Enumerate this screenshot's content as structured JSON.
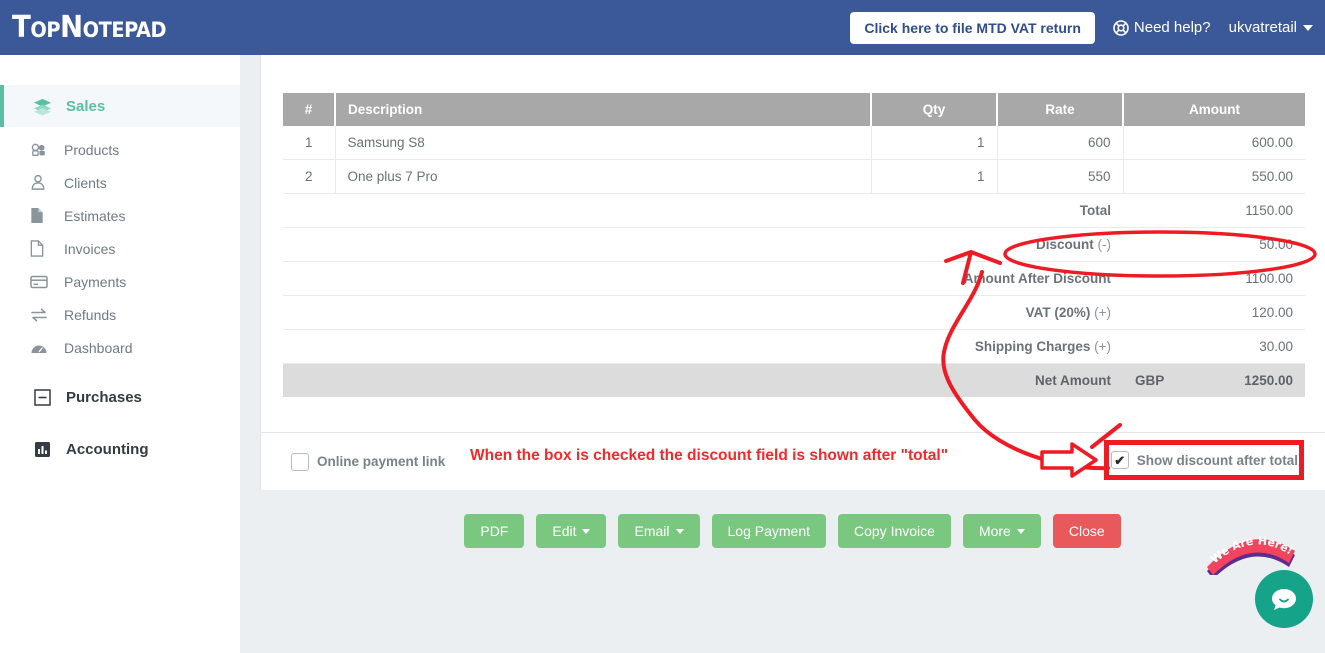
{
  "header": {
    "logo": "TopNotepad",
    "mtd_button": "Click here to file MTD VAT return",
    "need_help": "Need help?",
    "help_icon": "lifebuoy-icon",
    "user": "ukvatretail",
    "caret_icon": "caret-down-icon"
  },
  "sidebar": {
    "groups": [
      {
        "label": "Sales",
        "icon": "layers-icon",
        "active": true
      },
      {
        "label": "Purchases",
        "icon": "minus-square-icon",
        "active": false
      },
      {
        "label": "Accounting",
        "icon": "bar-chart-icon",
        "active": false
      }
    ],
    "sales_items": [
      {
        "label": "Products",
        "icon": "boxes-icon"
      },
      {
        "label": "Clients",
        "icon": "user-icon"
      },
      {
        "label": "Estimates",
        "icon": "document-filled-icon"
      },
      {
        "label": "Invoices",
        "icon": "document-outline-icon"
      },
      {
        "label": "Payments",
        "icon": "credit-card-icon"
      },
      {
        "label": "Refunds",
        "icon": "exchange-arrows-icon"
      },
      {
        "label": "Dashboard",
        "icon": "gauge-icon"
      }
    ]
  },
  "invoice": {
    "columns": [
      "#",
      "Description",
      "Qty",
      "Rate",
      "Amount"
    ],
    "rows": [
      {
        "idx": "1",
        "description": "Samsung S8",
        "qty": "1",
        "rate": "600",
        "amount": "600.00"
      },
      {
        "idx": "2",
        "description": "One plus 7 Pro",
        "qty": "1",
        "rate": "550",
        "amount": "550.00"
      }
    ],
    "summary": [
      {
        "label": "Total",
        "sign": "",
        "value": "1150.00"
      },
      {
        "label": "Discount",
        "sign": " (-)",
        "value": "50.00"
      },
      {
        "label": "Amount After Discount",
        "sign": "",
        "value": "1100.00"
      },
      {
        "label": "VAT (20%)",
        "sign": " (+)",
        "value": "120.00"
      },
      {
        "label": "Shipping Charges",
        "sign": " (+)",
        "value": "30.00"
      }
    ],
    "net": {
      "label": "Net Amount",
      "currency": "GBP",
      "value": "1250.00"
    }
  },
  "footer": {
    "online_payment_label": "Online payment link",
    "online_payment_checked": false,
    "show_discount_label": "Show discount after total",
    "show_discount_checked": true,
    "check_glyph": "✔"
  },
  "actions": [
    {
      "label": "PDF",
      "caret": false,
      "style": "green"
    },
    {
      "label": "Edit",
      "caret": true,
      "style": "green"
    },
    {
      "label": "Email",
      "caret": true,
      "style": "green"
    },
    {
      "label": "Log Payment",
      "caret": false,
      "style": "green"
    },
    {
      "label": "Copy Invoice",
      "caret": false,
      "style": "green"
    },
    {
      "label": "More",
      "caret": true,
      "style": "green"
    },
    {
      "label": "Close",
      "caret": false,
      "style": "red"
    }
  ],
  "annotation": {
    "text": "When the box is checked the discount field is shown after \"total\"",
    "color": "#ef2b2b"
  },
  "chat": {
    "banner_text": "We Are Here!",
    "banner_color": "#f4435c",
    "bubble_color": "#15a38a",
    "icon": "chat-bubble-icon"
  },
  "colors": {
    "header_blue": "#3b5998",
    "accent_green": "#5bbfa5",
    "button_green": "#7ac77f",
    "button_red": "#e9595b",
    "table_header_grey": "#a8a8a8",
    "net_row_grey": "#dcdcdc",
    "annotation_red": "#ee1b24"
  }
}
